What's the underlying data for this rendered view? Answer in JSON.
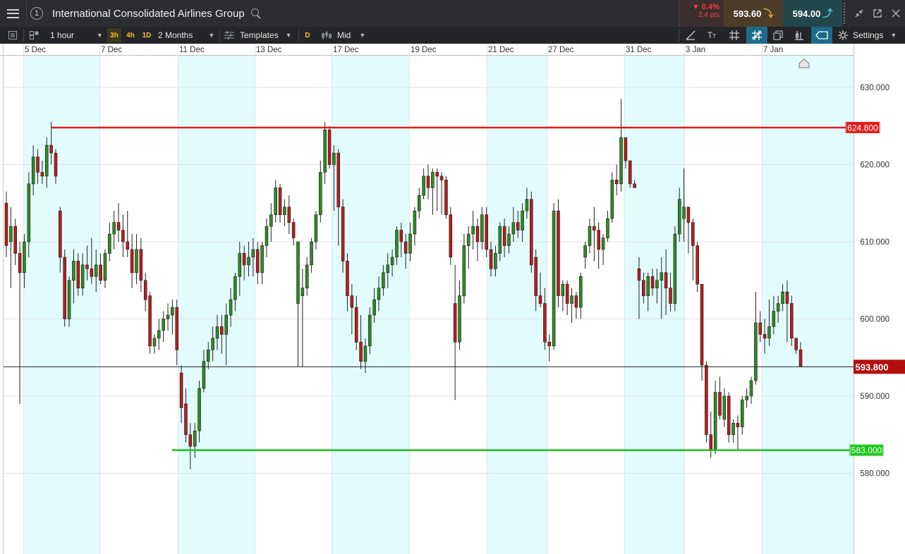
{
  "header": {
    "menu_icon": "hamburger-menu-icon",
    "instance_number": "1",
    "title": "International Consolidated Airlines Group",
    "search_icon": "search-icon",
    "change_pct": "▼ 0.4%",
    "change_pts": "2.4 pts",
    "sell_price": "593.60",
    "buy_price": "594.00",
    "sell_arrow": "⤵",
    "buy_arrow": "⤴"
  },
  "toolbar": {
    "interval": "1 hour",
    "quick_3h": "3h",
    "quick_4h": "4h",
    "quick_1d": "1D",
    "range": "2 Months",
    "templates": "Templates",
    "d_button": "D",
    "price_type": "Mid",
    "settings": "Settings"
  },
  "colors": {
    "up": "#2e8b22",
    "down": "#b81d1d",
    "resistance": "#e01b1b",
    "support": "#18c718",
    "shade": "#e2fbfd",
    "current_price_bg": "#b50e0e"
  },
  "chart_data": {
    "type": "candlestick",
    "x_labels": [
      "5 Dec",
      "7 Dec",
      "11 Dec",
      "13 Dec",
      "17 Dec",
      "19 Dec",
      "21 Dec",
      "27 Dec",
      "31 Dec",
      "3 Jan",
      "7 Jan"
    ],
    "y_ticks": [
      "630.000",
      "620.000",
      "610.000",
      "600.000",
      "590.000",
      "580.000"
    ],
    "ylim": [
      576,
      635
    ],
    "resistance_label": "624.800",
    "support_label": "583.000",
    "current_label": "593.800",
    "resistance": 624.8,
    "support": 583.0,
    "current": 593.8,
    "candles": [
      [
        615.0,
        616.5,
        608.0,
        609.5
      ],
      [
        610.0,
        614.5,
        604.0,
        612.0
      ],
      [
        612.0,
        613.0,
        607.0,
        608.5
      ],
      [
        608.5,
        610.0,
        589.0,
        606.0
      ],
      [
        606.0,
        611.0,
        604.0,
        610.0
      ],
      [
        610.0,
        619.0,
        608.0,
        617.5
      ],
      [
        617.5,
        622.5,
        616.0,
        621.0
      ],
      [
        621.0,
        622.0,
        617.5,
        619.0
      ],
      [
        619.0,
        620.5,
        617.5,
        618.5
      ],
      [
        618.5,
        623.5,
        617.0,
        622.5
      ],
      [
        622.5,
        625.5,
        620.0,
        621.5
      ],
      [
        621.5,
        622.0,
        617.5,
        618.5
      ],
      [
        614.0,
        614.5,
        606.0,
        608.0
      ],
      [
        608.0,
        609.0,
        599.0,
        600.0
      ],
      [
        600.0,
        605.5,
        599.0,
        605.0
      ],
      [
        605.0,
        609.0,
        602.0,
        607.5
      ],
      [
        607.5,
        608.5,
        603.0,
        604.0
      ],
      [
        604.0,
        608.5,
        603.0,
        607.0
      ],
      [
        607.0,
        609.5,
        605.0,
        606.5
      ],
      [
        606.5,
        610.5,
        604.5,
        605.5
      ],
      [
        605.5,
        609.0,
        603.5,
        607.0
      ],
      [
        607.0,
        608.5,
        604.5,
        605.0
      ],
      [
        605.0,
        609.0,
        604.0,
        608.5
      ],
      [
        608.5,
        612.5,
        607.5,
        611.0
      ],
      [
        611.0,
        614.0,
        609.0,
        612.5
      ],
      [
        612.5,
        615.0,
        610.0,
        611.5
      ],
      [
        611.5,
        613.5,
        608.0,
        610.0
      ],
      [
        610.0,
        614.0,
        608.0,
        609.0
      ],
      [
        609.0,
        611.0,
        604.0,
        606.0
      ],
      [
        606.0,
        611.0,
        604.5,
        609.0
      ],
      [
        609.0,
        610.5,
        603.5,
        605.0
      ],
      [
        605.0,
        606.0,
        601.0,
        602.5
      ],
      [
        603.0,
        603.5,
        595.5,
        596.5
      ],
      [
        596.5,
        598.0,
        595.5,
        597.5
      ],
      [
        597.5,
        600.0,
        596.0,
        598.5
      ],
      [
        598.5,
        601.0,
        597.0,
        600.0
      ],
      [
        600.0,
        602.0,
        598.5,
        600.5
      ],
      [
        600.5,
        602.5,
        598.0,
        601.5
      ],
      [
        601.5,
        602.5,
        594.0,
        596.0
      ],
      [
        593.0,
        594.0,
        586.5,
        588.5
      ],
      [
        589.0,
        591.0,
        584.0,
        585.0
      ],
      [
        585.0,
        586.5,
        580.5,
        583.5
      ],
      [
        583.5,
        586.5,
        582.0,
        585.5
      ],
      [
        585.5,
        592.0,
        584.0,
        591.0
      ],
      [
        591.0,
        596.0,
        590.5,
        594.5
      ],
      [
        594.5,
        597.0,
        593.5,
        596.0
      ],
      [
        596.0,
        599.0,
        594.5,
        597.5
      ],
      [
        597.5,
        600.5,
        596.0,
        599.0
      ],
      [
        599.0,
        600.5,
        595.5,
        598.0
      ],
      [
        598.0,
        602.0,
        594.0,
        600.5
      ],
      [
        600.5,
        604.0,
        599.0,
        602.5
      ],
      [
        602.5,
        606.0,
        601.0,
        605.5
      ],
      [
        605.5,
        610.0,
        603.0,
        608.5
      ],
      [
        608.5,
        609.5,
        605.0,
        607.0
      ],
      [
        607.0,
        610.0,
        605.5,
        608.0
      ],
      [
        608.0,
        610.5,
        605.5,
        609.0
      ],
      [
        609.0,
        610.0,
        604.5,
        606.0
      ],
      [
        606.0,
        610.0,
        604.5,
        609.5
      ],
      [
        609.5,
        613.0,
        608.0,
        612.0
      ],
      [
        612.0,
        615.0,
        610.0,
        613.5
      ],
      [
        613.5,
        618.0,
        612.5,
        617.0
      ],
      [
        617.0,
        617.5,
        612.5,
        613.5
      ],
      [
        613.5,
        615.5,
        612.0,
        614.5
      ],
      [
        614.5,
        616.0,
        611.0,
        612.5
      ],
      [
        612.5,
        613.0,
        609.5,
        610.5
      ],
      [
        602.0,
        610.0,
        593.8,
        610.0
      ],
      [
        603.0,
        606.5,
        593.8,
        604.0
      ],
      [
        604.0,
        608.0,
        603.0,
        607.0
      ],
      [
        607.0,
        610.5,
        606.0,
        610.0
      ],
      [
        610.0,
        614.0,
        609.0,
        613.5
      ],
      [
        613.5,
        620.5,
        612.5,
        619.0
      ],
      [
        619.0,
        625.5,
        617.5,
        624.5
      ],
      [
        624.5,
        625.0,
        619.5,
        620.0
      ],
      [
        620.0,
        622.5,
        614.0,
        621.5
      ],
      [
        621.5,
        622.0,
        609.5,
        614.5
      ],
      [
        614.5,
        615.5,
        606.0,
        607.5
      ],
      [
        607.5,
        608.5,
        601.0,
        603.0
      ],
      [
        603.0,
        604.5,
        598.0,
        601.5
      ],
      [
        601.5,
        603.0,
        596.0,
        597.0
      ],
      [
        597.0,
        600.5,
        593.5,
        594.5
      ],
      [
        594.5,
        597.5,
        593.0,
        596.5
      ],
      [
        596.5,
        601.5,
        595.5,
        600.5
      ],
      [
        600.5,
        604.0,
        599.5,
        602.5
      ],
      [
        602.5,
        605.5,
        601.0,
        604.0
      ],
      [
        604.0,
        607.0,
        603.0,
        606.0
      ],
      [
        606.0,
        608.5,
        604.0,
        607.0
      ],
      [
        607.0,
        609.0,
        605.5,
        608.0
      ],
      [
        608.0,
        612.0,
        607.0,
        611.5
      ],
      [
        611.5,
        612.5,
        608.0,
        610.0
      ],
      [
        610.0,
        611.0,
        606.5,
        608.5
      ],
      [
        608.5,
        612.5,
        607.5,
        611.0
      ],
      [
        611.0,
        614.5,
        609.5,
        614.0
      ],
      [
        614.0,
        617.0,
        613.0,
        616.0
      ],
      [
        616.0,
        619.5,
        615.5,
        618.5
      ],
      [
        618.5,
        620.0,
        615.5,
        617.0
      ],
      [
        617.0,
        619.5,
        613.5,
        619.0
      ],
      [
        619.0,
        619.5,
        614.0,
        618.5
      ],
      [
        618.5,
        619.0,
        613.5,
        618.0
      ],
      [
        618.0,
        618.5,
        613.0,
        613.5
      ],
      [
        613.5,
        614.5,
        607.0,
        608.0
      ],
      [
        602.0,
        607.0,
        589.5,
        597.0
      ],
      [
        597.0,
        605.0,
        596.0,
        603.0
      ],
      [
        603.0,
        611.0,
        602.0,
        609.5
      ],
      [
        609.5,
        612.0,
        606.5,
        611.0
      ],
      [
        611.0,
        614.0,
        609.0,
        612.0
      ],
      [
        612.0,
        613.0,
        607.5,
        610.0
      ],
      [
        610.0,
        614.5,
        609.0,
        613.5
      ],
      [
        613.5,
        614.5,
        608.0,
        609.0
      ],
      [
        609.0,
        610.0,
        605.5,
        606.5
      ],
      [
        606.5,
        609.5,
        605.5,
        608.5
      ],
      [
        608.5,
        612.5,
        607.5,
        612.0
      ],
      [
        612.0,
        613.0,
        608.0,
        609.5
      ],
      [
        609.5,
        612.0,
        608.5,
        611.0
      ],
      [
        611.0,
        614.5,
        610.0,
        612.5
      ],
      [
        612.5,
        614.0,
        610.5,
        611.5
      ],
      [
        611.5,
        615.0,
        610.0,
        614.0
      ],
      [
        614.0,
        617.0,
        613.0,
        615.5
      ],
      [
        615.5,
        616.5,
        606.0,
        607.0
      ],
      [
        608.0,
        609.0,
        601.0,
        603.0
      ],
      [
        603.0,
        606.0,
        601.5,
        602.0
      ],
      [
        602.0,
        604.0,
        596.0,
        597.0
      ],
      [
        597.0,
        598.0,
        594.5,
        596.5
      ],
      [
        596.5,
        615.0,
        596.0,
        614.0
      ],
      [
        614.0,
        615.5,
        601.5,
        603.0
      ],
      [
        603.0,
        605.0,
        601.0,
        604.5
      ],
      [
        604.5,
        605.0,
        600.5,
        602.0
      ],
      [
        602.0,
        604.0,
        599.5,
        603.0
      ],
      [
        603.0,
        603.5,
        600.0,
        601.5
      ],
      [
        601.5,
        606.0,
        600.0,
        605.5
      ],
      [
        608.0,
        610.0,
        606.5,
        609.5
      ],
      [
        609.5,
        613.0,
        608.5,
        612.0
      ],
      [
        612.0,
        614.5,
        607.5,
        611.5
      ],
      [
        611.5,
        612.5,
        606.5,
        609.0
      ],
      [
        609.0,
        611.0,
        607.0,
        610.5
      ],
      [
        610.5,
        614.0,
        610.0,
        613.0
      ],
      [
        613.0,
        619.0,
        612.5,
        618.0
      ],
      [
        618.0,
        620.0,
        616.0,
        617.5
      ],
      [
        617.5,
        628.5,
        616.5,
        623.5
      ],
      [
        623.5,
        623.5,
        619.5,
        620.5
      ],
      [
        620.5,
        620.5,
        617.0,
        617.5
      ],
      [
        617.5,
        618.0,
        617.0,
        617.0
      ],
      [
        606.5,
        608.0,
        600.0,
        605.0
      ],
      [
        605.0,
        606.0,
        602.0,
        603.0
      ],
      [
        603.0,
        606.0,
        601.0,
        605.5
      ],
      [
        605.5,
        606.5,
        603.0,
        604.0
      ],
      [
        604.0,
        606.5,
        602.0,
        605.0
      ],
      [
        605.0,
        608.0,
        600.0,
        606.0
      ],
      [
        606.0,
        609.0,
        600.5,
        604.0
      ],
      [
        604.0,
        606.0,
        601.0,
        602.0
      ],
      [
        602.0,
        612.0,
        601.0,
        611.0
      ],
      [
        611.0,
        617.0,
        610.0,
        615.5
      ],
      [
        613.0,
        619.5,
        610.0,
        614.5
      ],
      [
        614.5,
        614.5,
        608.5,
        612.5
      ],
      [
        612.5,
        613.0,
        605.0,
        609.5
      ],
      [
        609.5,
        610.0,
        603.5,
        604.5
      ],
      [
        604.5,
        604.5,
        592.0,
        594.0
      ],
      [
        594.0,
        594.5,
        584.0,
        585.0
      ],
      [
        585.0,
        588.0,
        582.0,
        583.0
      ],
      [
        583.0,
        592.0,
        582.5,
        590.5
      ],
      [
        590.5,
        592.5,
        587.0,
        587.5
      ],
      [
        587.0,
        591.0,
        586.0,
        590.0
      ],
      [
        590.0,
        590.5,
        584.0,
        585.0
      ],
      [
        585.0,
        587.0,
        584.0,
        586.5
      ],
      [
        586.5,
        587.5,
        583.0,
        586.0
      ],
      [
        586.0,
        590.0,
        585.0,
        589.5
      ],
      [
        589.5,
        591.0,
        588.5,
        590.0
      ],
      [
        590.0,
        592.5,
        589.0,
        592.0
      ],
      [
        592.0,
        603.5,
        591.5,
        599.5
      ],
      [
        599.5,
        601.0,
        597.0,
        598.0
      ],
      [
        598.0,
        600.0,
        595.5,
        597.5
      ],
      [
        597.5,
        602.5,
        596.5,
        599.0
      ],
      [
        599.0,
        603.0,
        598.0,
        601.0
      ],
      [
        601.0,
        603.0,
        599.5,
        602.0
      ],
      [
        602.0,
        604.5,
        601.0,
        603.5
      ],
      [
        603.5,
        605.0,
        597.0,
        602.0
      ],
      [
        602.0,
        603.0,
        596.5,
        597.5
      ],
      [
        597.5,
        597.5,
        595.5,
        596.0
      ],
      [
        596.0,
        597.0,
        593.8,
        593.8
      ]
    ]
  }
}
